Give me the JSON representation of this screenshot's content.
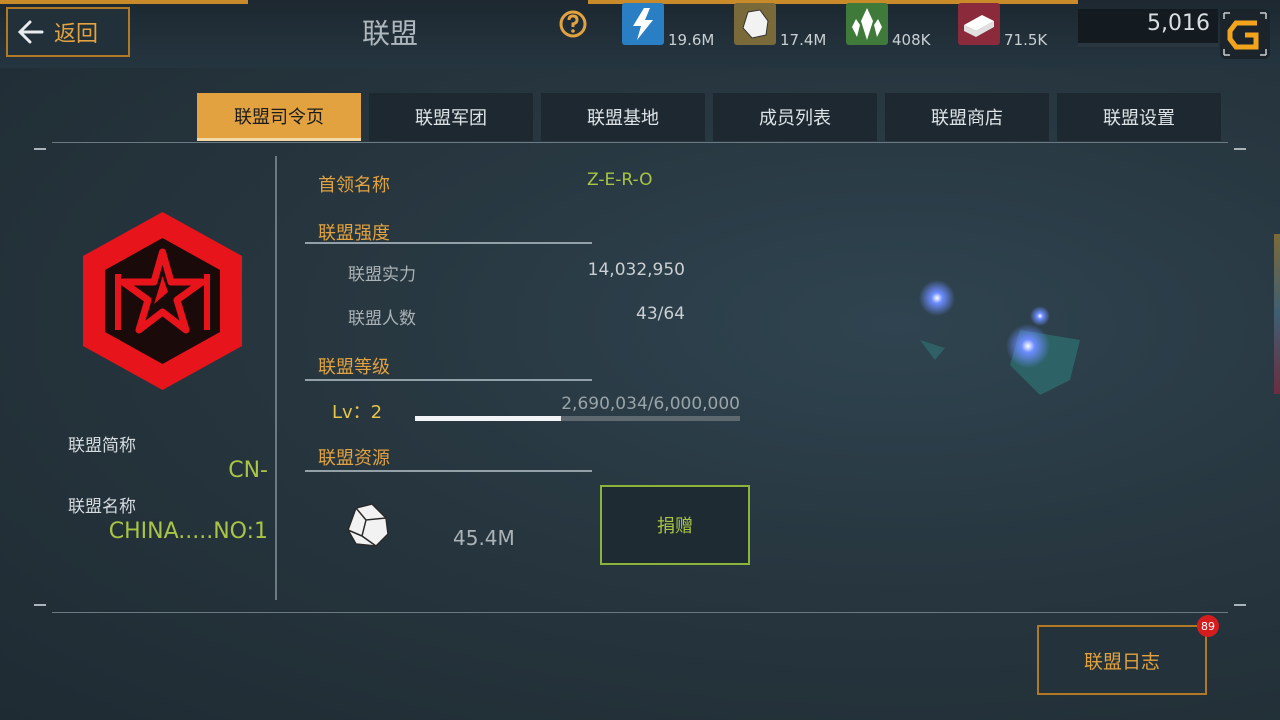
{
  "header": {
    "back_label": "返回",
    "title": "联盟",
    "resources": [
      {
        "icon": "blue-lightning-icon",
        "value": "19.6M",
        "color": "#2a7fc4"
      },
      {
        "icon": "stone-ore-icon",
        "value": "17.4M",
        "color": "#7a6a3a"
      },
      {
        "icon": "green-crystal-icon",
        "value": "408K",
        "color": "#3f7a3a"
      },
      {
        "icon": "red-ingot-icon",
        "value": "71.5K",
        "color": "#8a2a3a"
      }
    ],
    "credits": "5,016"
  },
  "tabs": [
    {
      "label": "联盟司令页",
      "active": true
    },
    {
      "label": "联盟军团",
      "active": false
    },
    {
      "label": "联盟基地",
      "active": false
    },
    {
      "label": "成员列表",
      "active": false
    },
    {
      "label": "联盟商店",
      "active": false
    },
    {
      "label": "联盟设置",
      "active": false
    }
  ],
  "left_panel": {
    "short_name_label": "联盟简称",
    "short_name_value": "CN-",
    "full_name_label": "联盟名称",
    "full_name_value": "CHINA.....NO:1"
  },
  "info": {
    "leader_label": "首领名称",
    "leader_value": "Z-E-R-O",
    "strength_title": "联盟强度",
    "power_label": "联盟实力",
    "power_value": "14,032,950",
    "members_label": "联盟人数",
    "members_value": "43/64",
    "level_title": "联盟等级",
    "level_text": "Lv：2",
    "xp_text": "2,690,034/6,000,000",
    "xp_fraction": 0.448,
    "resources_title": "联盟资源",
    "resource_amount": "45.4M",
    "donate_label": "捐赠"
  },
  "footer": {
    "log_label": "联盟日志",
    "log_badge": "89"
  },
  "colors": {
    "accent_orange": "#e1a23f",
    "accent_green": "#a8c545",
    "emblem_red": "#e8141b"
  }
}
